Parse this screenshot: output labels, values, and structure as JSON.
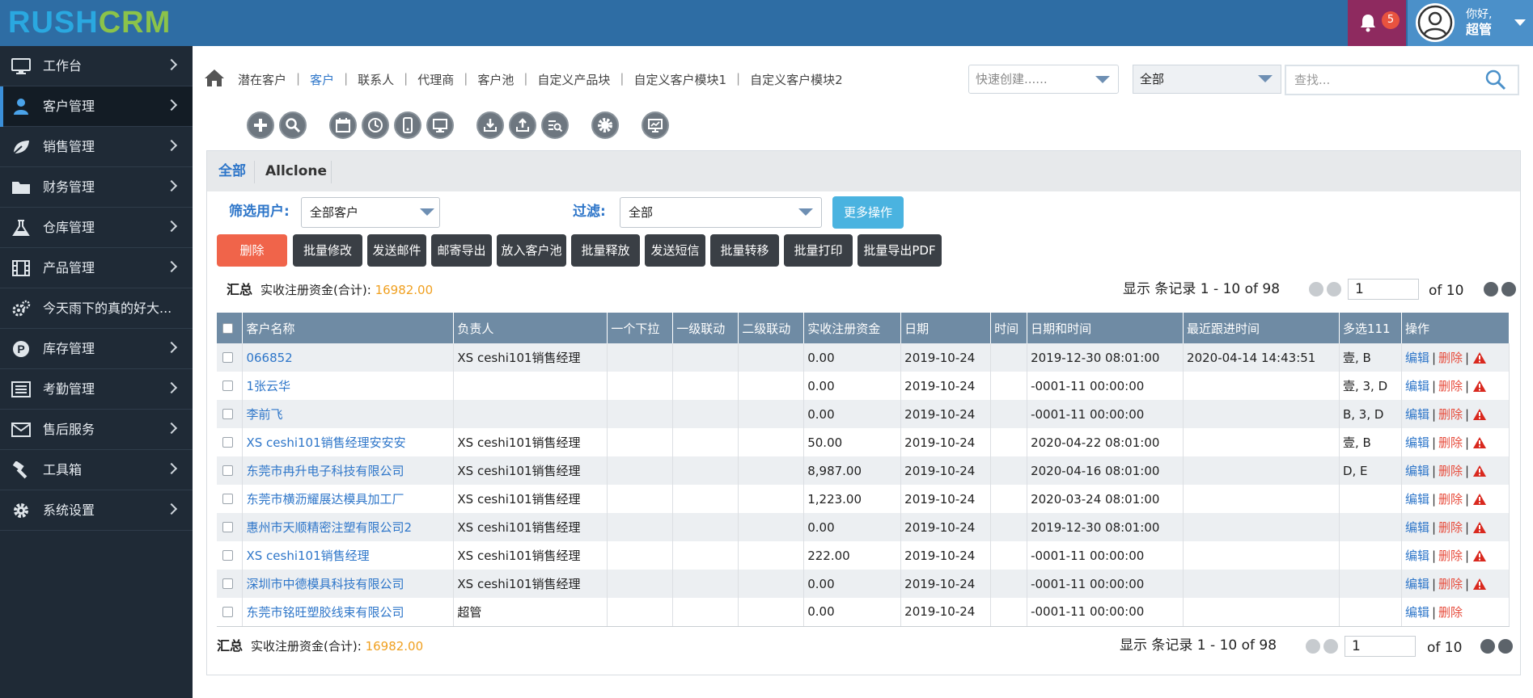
{
  "brand": {
    "part1": "RUSH",
    "part2": "CRM"
  },
  "header": {
    "notification_count": "5",
    "greeting": "你好,",
    "user_name": "超管"
  },
  "sidebar": {
    "items": [
      {
        "label": "工作台",
        "icon": "monitor-icon"
      },
      {
        "label": "客户管理",
        "icon": "user-icon",
        "active": true
      },
      {
        "label": "销售管理",
        "icon": "leaf-icon"
      },
      {
        "label": "财务管理",
        "icon": "folder-icon"
      },
      {
        "label": "仓库管理",
        "icon": "flask-icon"
      },
      {
        "label": "产品管理",
        "icon": "film-icon"
      },
      {
        "label": "今天雨下的真的好大...",
        "icon": "gears-icon"
      },
      {
        "label": "库存管理",
        "icon": "p-circle-icon"
      },
      {
        "label": "考勤管理",
        "icon": "list-icon"
      },
      {
        "label": "售后服务",
        "icon": "envelope-icon"
      },
      {
        "label": "工具箱",
        "icon": "hammer-icon"
      },
      {
        "label": "系统设置",
        "icon": "gear-icon"
      }
    ]
  },
  "nav": {
    "links": [
      "潜在客户",
      "客户",
      "联系人",
      "代理商",
      "客户池",
      "自定义产品块",
      "自定义客户模块1",
      "自定义客户模块2"
    ],
    "active_index": 1
  },
  "quick_create": {
    "placeholder": "快速创建......"
  },
  "scope_select": {
    "value": "全部"
  },
  "search": {
    "placeholder": "查找..."
  },
  "tabs": {
    "all": "全部",
    "clone": "Allclone"
  },
  "filter": {
    "user_label": "筛选用户:",
    "user_value": "全部客户",
    "filter_label": "过滤:",
    "filter_value": "全部",
    "more_ops": "更多操作"
  },
  "actions": [
    "删除",
    "批量修改",
    "发送邮件",
    "邮寄导出",
    "放入客户池",
    "批量释放",
    "发送短信",
    "批量转移",
    "批量打印",
    "批量导出PDF"
  ],
  "summary": {
    "title": "汇总",
    "label": "实收注册资金(合计):",
    "amount": "16982.00"
  },
  "pager": {
    "records_text": "显示 条记录 1 - 10 of 98",
    "page": "1",
    "of_text": "of 10"
  },
  "table": {
    "headers": [
      "客户名称",
      "负责人",
      "一个下拉",
      "一级联动",
      "二级联动",
      "实收注册资金",
      "日期",
      "时间",
      "日期和时间",
      "最近跟进时间",
      "多选111",
      "操作"
    ],
    "edit_label": "编辑",
    "delete_label": "删除",
    "rows": [
      {
        "name": "066852",
        "owner": "XS ceshi101销售经理",
        "capital": "0.00",
        "date": "2019-10-24",
        "datetime": "2019-12-30 08:01:00",
        "followup": "2020-04-14 14:43:51",
        "multi": "壹, B",
        "warn": true
      },
      {
        "name": "1张云华",
        "owner": "",
        "capital": "0.00",
        "date": "2019-10-24",
        "datetime": "-0001-11 00:00:00",
        "followup": "",
        "multi": "壹, 3, D",
        "warn": true
      },
      {
        "name": "李前飞",
        "owner": "",
        "capital": "0.00",
        "date": "2019-10-24",
        "datetime": "-0001-11 00:00:00",
        "followup": "",
        "multi": "B, 3, D",
        "warn": true
      },
      {
        "name": "XS ceshi101销售经理安安安",
        "owner": "XS ceshi101销售经理",
        "capital": "50.00",
        "date": "2019-10-24",
        "datetime": "2020-04-22 08:01:00",
        "followup": "",
        "multi": "壹, B",
        "warn": true
      },
      {
        "name": "东莞市冉升电子科技有限公司",
        "owner": "XS ceshi101销售经理",
        "capital": "8,987.00",
        "date": "2019-10-24",
        "datetime": "2020-04-16 08:01:00",
        "followup": "",
        "multi": "D, E",
        "warn": true
      },
      {
        "name": "东莞市横沥耀展达模具加工厂",
        "owner": "XS ceshi101销售经理",
        "capital": "1,223.00",
        "date": "2019-10-24",
        "datetime": "2020-03-24 08:01:00",
        "followup": "",
        "multi": "",
        "warn": true
      },
      {
        "name": "惠州市天顺精密注塑有限公司2",
        "owner": "XS ceshi101销售经理",
        "capital": "0.00",
        "date": "2019-10-24",
        "datetime": "2019-12-30 08:01:00",
        "followup": "",
        "multi": "",
        "warn": true
      },
      {
        "name": "XS ceshi101销售经理",
        "owner": "XS ceshi101销售经理",
        "capital": "222.00",
        "date": "2019-10-24",
        "datetime": "-0001-11 00:00:00",
        "followup": "",
        "multi": "",
        "warn": true
      },
      {
        "name": "深圳市中德模具科技有限公司",
        "owner": "XS ceshi101销售经理",
        "capital": "0.00",
        "date": "2019-10-24",
        "datetime": "-0001-11 00:00:00",
        "followup": "",
        "multi": "",
        "warn": true
      },
      {
        "name": "东莞市铭旺塑胶线束有限公司",
        "owner": "超管",
        "capital": "0.00",
        "date": "2019-10-24",
        "datetime": "-0001-11 00:00:00",
        "followup": "",
        "multi": "",
        "warn": false
      }
    ]
  },
  "colors": {
    "topbar": "#2e6da4",
    "sidebar": "#1f2a36",
    "accent": "#2e76c9",
    "danger": "#e74c3c",
    "amount": "#f0a020"
  }
}
